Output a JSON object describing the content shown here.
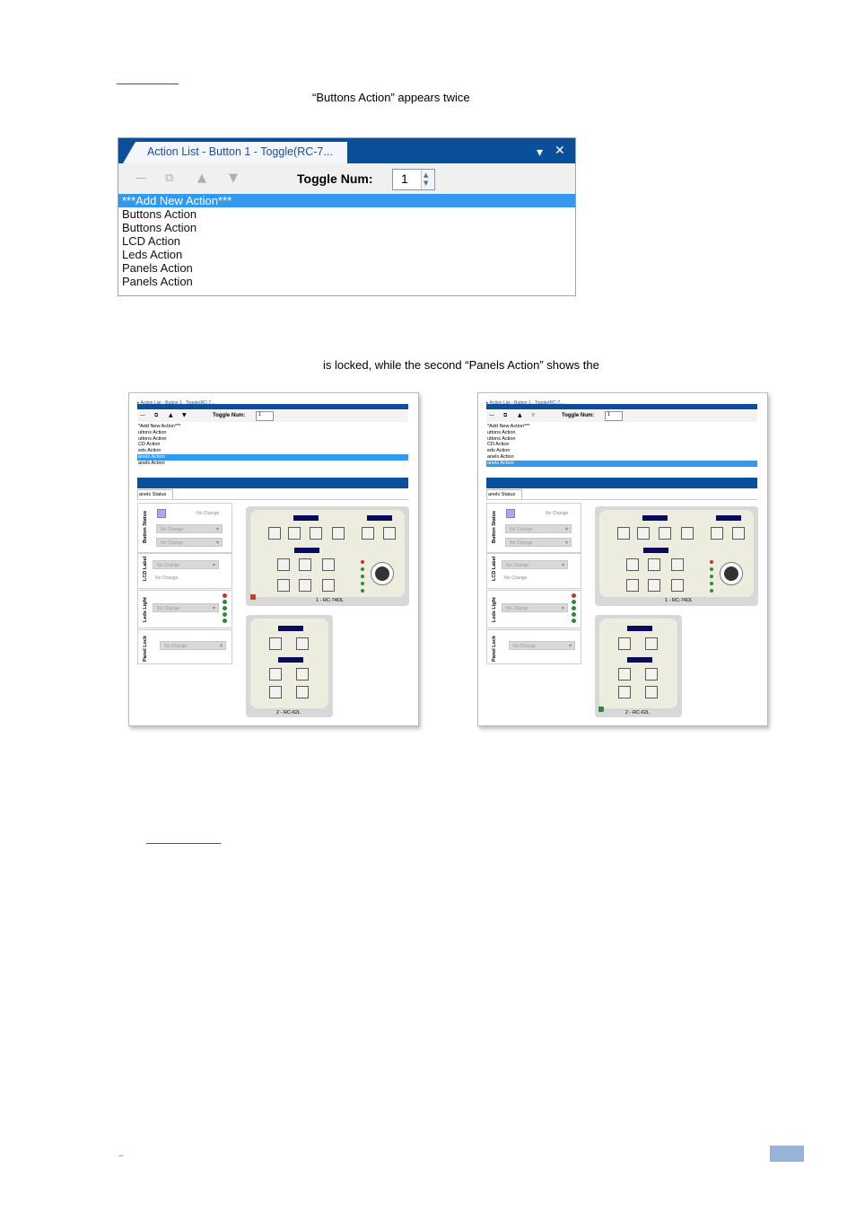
{
  "document": {
    "caption_top": "“Buttons Action” appears twice",
    "caption_middle": "is locked, while the second “Panels Action” shows the"
  },
  "action_window": {
    "tab_title": "Action List - Button 1 - Toggle(RC-7...",
    "toggle_label": "Toggle Num:",
    "toggle_value": "1",
    "window_controls": [
      "▾",
      "✕"
    ],
    "toolbar_icons": [
      "minus-icon",
      "copy-icon",
      "up-arrow-icon",
      "down-arrow-icon"
    ],
    "items": [
      {
        "label": "***Add New Action***",
        "selected": true
      },
      {
        "label": "Buttons Action",
        "selected": false
      },
      {
        "label": "Buttons Action",
        "selected": false
      },
      {
        "label": "LCD Action",
        "selected": false
      },
      {
        "label": "Leds Action",
        "selected": false
      },
      {
        "label": "Panels Action",
        "selected": false
      },
      {
        "label": "Panels Action",
        "selected": false
      }
    ]
  },
  "small_shots": {
    "toggle_label": "Toggle Num:",
    "toggle_value": "1",
    "list_items": [
      "*Add New Action***",
      "uttons Action",
      "uttons Action",
      "CD Action",
      "eds Action",
      "anels Action",
      "anels Action"
    ],
    "panels_tab": "anels Status",
    "group_labels": [
      "Button Status",
      "LCD Label",
      "Leds Light",
      "Panel Lock"
    ],
    "no_change": "No Change",
    "device1_label": "1 - RC-74DL",
    "device2_label": "2 - RC-62L",
    "left": {
      "selected_index": 5
    },
    "right": {
      "selected_index": 6
    }
  },
  "colors": {
    "title_blue": "#0b4f9c",
    "selection": "#3399ee",
    "lcd": "#0a0a5c",
    "led_red": "#c0392b",
    "led_green": "#2e8b3a",
    "lock_red": "#d0392b",
    "unlock_green": "#2e8b3a"
  }
}
